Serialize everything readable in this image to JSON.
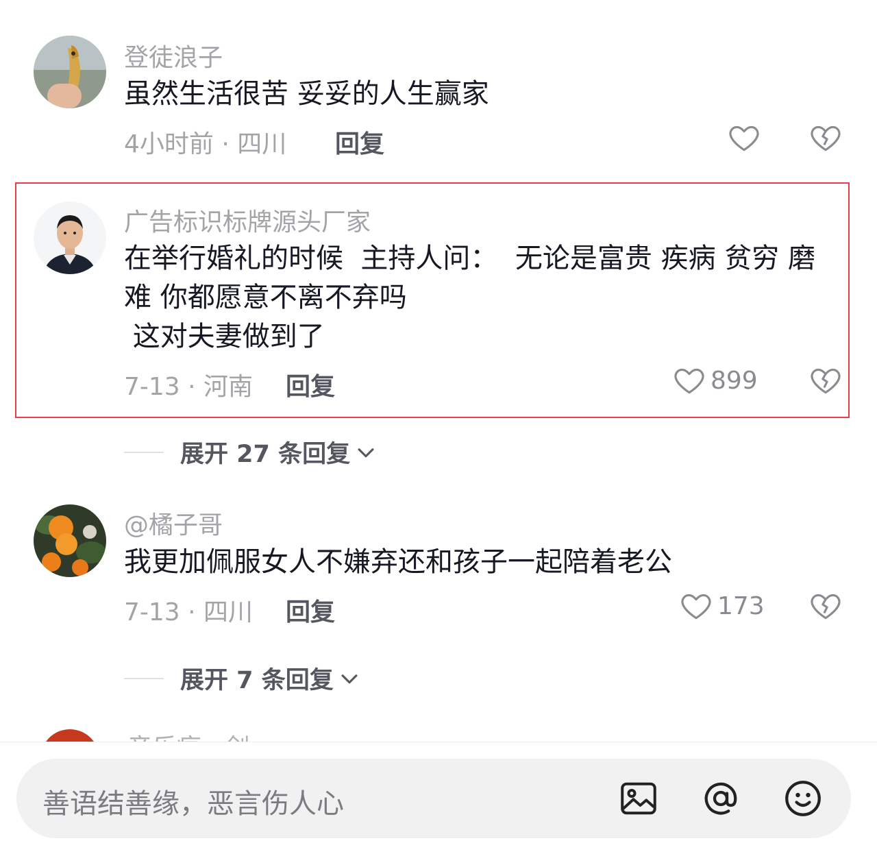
{
  "comments": [
    {
      "username": "登徒浪子",
      "text": "虽然生活很苦 妥妥的人生赢家",
      "meta": "4小时前 · 四川",
      "reply_label": "回复",
      "likes": ""
    },
    {
      "username": "广告标识标牌源头厂家",
      "text": "在举行婚礼的时候  主持人问：  无论是富贵 疾病 贫穷 磨难 你都愿意不离不弃吗\n 这对夫妻做到了",
      "meta": "7-13 · 河南",
      "reply_label": "回复",
      "likes": "899",
      "expand_label": "展开 27 条回复"
    },
    {
      "username": "@橘子哥",
      "text": "我更加佩服女人不嫌弃还和孩子一起陪着老公",
      "meta": "7-13 · 四川",
      "reply_label": "回复",
      "likes": "173",
      "expand_label": "展开 7 条回复"
    },
    {
      "username": "音乐疯 · 剑"
    }
  ],
  "input": {
    "placeholder": "善语结善缘，恶言伤人心"
  },
  "colors": {
    "highlight": "#ec3b48",
    "secondary_text": "#a3a4a8",
    "input_bg": "#f1f1f2"
  },
  "icons": [
    "heart-icon",
    "broken-heart-icon",
    "image-icon",
    "at-icon",
    "emoji-icon",
    "chevron-down-icon"
  ]
}
